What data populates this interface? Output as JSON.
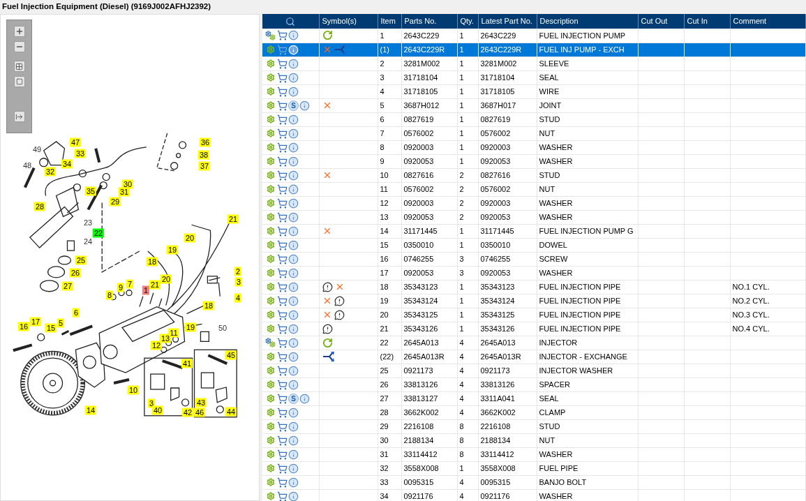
{
  "title": "Fuel Injection Equipment (Diesel) (9169J002AFHJ2392)",
  "diagram": {
    "callouts": [
      {
        "label": "47",
        "color": "#ffff00"
      },
      {
        "label": "49"
      },
      {
        "label": "48"
      },
      {
        "label": "33",
        "color": "#ffff00"
      },
      {
        "label": "34",
        "color": "#ffff00"
      },
      {
        "label": "32",
        "color": "#ffff00"
      },
      {
        "label": "36",
        "color": "#ffff00"
      },
      {
        "label": "38",
        "color": "#ffff00"
      },
      {
        "label": "37",
        "color": "#ffff00"
      },
      {
        "label": "30",
        "color": "#ffff00"
      },
      {
        "label": "31",
        "color": "#ffff00"
      },
      {
        "label": "35",
        "color": "#ffff00"
      },
      {
        "label": "29",
        "color": "#ffff00"
      },
      {
        "label": "28",
        "color": "#ffff00"
      },
      {
        "label": "23"
      },
      {
        "label": "22",
        "color": "#00ff00"
      },
      {
        "label": "24"
      },
      {
        "label": "21",
        "color": "#ffff00"
      },
      {
        "label": "20",
        "color": "#ffff00"
      },
      {
        "label": "19",
        "color": "#ffff00"
      },
      {
        "label": "18",
        "color": "#ffff00"
      },
      {
        "label": "25",
        "color": "#ffff00"
      },
      {
        "label": "26",
        "color": "#ffff00"
      },
      {
        "label": "27",
        "color": "#ffff00"
      },
      {
        "label": "2",
        "color": "#ffff00"
      },
      {
        "label": "3",
        "color": "#ffff00"
      },
      {
        "label": "4",
        "color": "#ffff00"
      },
      {
        "label": "1",
        "color": "#f08080"
      },
      {
        "label": "7",
        "color": "#ffff00"
      },
      {
        "label": "9",
        "color": "#ffff00"
      },
      {
        "label": "8",
        "color": "#ffff00"
      },
      {
        "label": "21",
        "color": "#ffff00"
      },
      {
        "label": "20",
        "color": "#ffff00"
      },
      {
        "label": "18",
        "color": "#ffff00"
      },
      {
        "label": "6",
        "color": "#ffff00"
      },
      {
        "label": "17",
        "color": "#ffff00"
      },
      {
        "label": "16",
        "color": "#ffff00"
      },
      {
        "label": "15",
        "color": "#ffff00"
      },
      {
        "label": "5",
        "color": "#ffff00"
      },
      {
        "label": "19",
        "color": "#ffff00"
      },
      {
        "label": "11",
        "color": "#ffff00"
      },
      {
        "label": "13",
        "color": "#ffff00"
      },
      {
        "label": "12",
        "color": "#ffff00"
      },
      {
        "label": "50"
      },
      {
        "label": "10",
        "color": "#ffff00"
      },
      {
        "label": "14",
        "color": "#ffff00"
      },
      {
        "label": "41",
        "color": "#ffff00"
      },
      {
        "label": "45",
        "color": "#ffff00"
      },
      {
        "label": "3",
        "color": "#ffff00"
      },
      {
        "label": "40",
        "color": "#ffff00"
      },
      {
        "label": "42",
        "color": "#ffff00"
      },
      {
        "label": "43",
        "color": "#ffff00"
      },
      {
        "label": "46",
        "color": "#ffff00"
      },
      {
        "label": "44",
        "color": "#ffff00"
      }
    ]
  },
  "table": {
    "columns": [
      "Symbol(s)",
      "Item",
      "Parts No.",
      "Qty.",
      "Latest Part No.",
      "Description",
      "Cut Out",
      "Cut In",
      "Comment"
    ],
    "rows": [
      {
        "icons": [
          {
            "kind": "gears"
          },
          {
            "kind": "cart"
          },
          {
            "kind": "info"
          }
        ],
        "symbols": [
          {
            "kind": "replaced"
          }
        ],
        "item": "1",
        "parts_no": "2643C229",
        "qty": "1",
        "latest": "2643C229",
        "description": "FUEL INJECTION PUMP",
        "selected": false
      },
      {
        "icons": [
          {
            "kind": "gear"
          },
          {
            "kind": "cart"
          },
          {
            "kind": "info"
          }
        ],
        "symbols": [
          {
            "kind": "cross"
          },
          {
            "kind": "exchange"
          }
        ],
        "item": "(1)",
        "parts_no": "2643C229R",
        "qty": "1",
        "latest": "2643C229R",
        "description": "FUEL INJ PUMP - EXCH",
        "selected": true
      },
      {
        "icons": [
          {
            "kind": "gear"
          },
          {
            "kind": "cart"
          },
          {
            "kind": "info"
          }
        ],
        "symbols": [],
        "item": "2",
        "parts_no": "3281M002",
        "qty": "1",
        "latest": "3281M002",
        "description": "SLEEVE",
        "selected": false
      },
      {
        "icons": [
          {
            "kind": "gear"
          },
          {
            "kind": "cart"
          },
          {
            "kind": "info"
          }
        ],
        "symbols": [],
        "item": "3",
        "parts_no": "31718104",
        "qty": "1",
        "latest": "31718104",
        "description": "SEAL",
        "selected": false
      },
      {
        "icons": [
          {
            "kind": "gear"
          },
          {
            "kind": "cart"
          },
          {
            "kind": "info"
          }
        ],
        "symbols": [],
        "item": "4",
        "parts_no": "31718105",
        "qty": "1",
        "latest": "31718105",
        "description": "WIRE",
        "selected": false
      },
      {
        "icons": [
          {
            "kind": "gear"
          },
          {
            "kind": "cart"
          },
          {
            "kind": "badge",
            "label": "S"
          },
          {
            "kind": "info"
          }
        ],
        "symbols": [
          {
            "kind": "cross"
          }
        ],
        "item": "5",
        "parts_no": "3687H012",
        "qty": "1",
        "latest": "3687H017",
        "description": "JOINT",
        "selected": false
      },
      {
        "icons": [
          {
            "kind": "gear"
          },
          {
            "kind": "cart"
          },
          {
            "kind": "info"
          }
        ],
        "symbols": [],
        "item": "6",
        "parts_no": "0827619",
        "qty": "1",
        "latest": "0827619",
        "description": "STUD",
        "selected": false
      },
      {
        "icons": [
          {
            "kind": "gear"
          },
          {
            "kind": "cart"
          },
          {
            "kind": "info"
          }
        ],
        "symbols": [],
        "item": "7",
        "parts_no": "0576002",
        "qty": "1",
        "latest": "0576002",
        "description": "NUT",
        "selected": false
      },
      {
        "icons": [
          {
            "kind": "gear"
          },
          {
            "kind": "cart"
          },
          {
            "kind": "info"
          }
        ],
        "symbols": [],
        "item": "8",
        "parts_no": "0920003",
        "qty": "1",
        "latest": "0920003",
        "description": "WASHER",
        "selected": false
      },
      {
        "icons": [
          {
            "kind": "gear"
          },
          {
            "kind": "cart"
          },
          {
            "kind": "info"
          }
        ],
        "symbols": [],
        "item": "9",
        "parts_no": "0920053",
        "qty": "1",
        "latest": "0920053",
        "description": "WASHER",
        "selected": false
      },
      {
        "icons": [
          {
            "kind": "gear"
          },
          {
            "kind": "cart"
          },
          {
            "kind": "info"
          }
        ],
        "symbols": [
          {
            "kind": "cross"
          }
        ],
        "item": "10",
        "parts_no": "0827616",
        "qty": "2",
        "latest": "0827616",
        "description": "STUD",
        "selected": false
      },
      {
        "icons": [
          {
            "kind": "gear"
          },
          {
            "kind": "cart"
          },
          {
            "kind": "info"
          }
        ],
        "symbols": [],
        "item": "11",
        "parts_no": "0576002",
        "qty": "2",
        "latest": "0576002",
        "description": "NUT",
        "selected": false
      },
      {
        "icons": [
          {
            "kind": "gear"
          },
          {
            "kind": "cart"
          },
          {
            "kind": "info"
          }
        ],
        "symbols": [],
        "item": "12",
        "parts_no": "0920003",
        "qty": "2",
        "latest": "0920003",
        "description": "WASHER",
        "selected": false
      },
      {
        "icons": [
          {
            "kind": "gear"
          },
          {
            "kind": "cart"
          },
          {
            "kind": "info"
          }
        ],
        "symbols": [],
        "item": "13",
        "parts_no": "0920053",
        "qty": "2",
        "latest": "0920053",
        "description": "WASHER",
        "selected": false
      },
      {
        "icons": [
          {
            "kind": "gear"
          },
          {
            "kind": "cart"
          },
          {
            "kind": "info"
          }
        ],
        "symbols": [
          {
            "kind": "cross"
          }
        ],
        "item": "14",
        "parts_no": "31171445",
        "qty": "1",
        "latest": "31171445",
        "description": "FUEL INJECTION PUMP G",
        "selected": false
      },
      {
        "icons": [
          {
            "kind": "gear"
          },
          {
            "kind": "cart"
          },
          {
            "kind": "info"
          }
        ],
        "symbols": [],
        "item": "15",
        "parts_no": "0350010",
        "qty": "1",
        "latest": "0350010",
        "description": "DOWEL",
        "selected": false
      },
      {
        "icons": [
          {
            "kind": "gear"
          },
          {
            "kind": "cart"
          },
          {
            "kind": "info"
          }
        ],
        "symbols": [],
        "item": "16",
        "parts_no": "0746255",
        "qty": "3",
        "latest": "0746255",
        "description": "SCREW",
        "selected": false
      },
      {
        "icons": [
          {
            "kind": "gear"
          },
          {
            "kind": "cart"
          },
          {
            "kind": "info"
          }
        ],
        "symbols": [],
        "item": "17",
        "parts_no": "0920053",
        "qty": "3",
        "latest": "0920053",
        "description": "WASHER",
        "selected": false
      },
      {
        "icons": [
          {
            "kind": "gear"
          },
          {
            "kind": "cart"
          },
          {
            "kind": "info"
          }
        ],
        "symbols": [
          {
            "kind": "note"
          },
          {
            "kind": "cross"
          }
        ],
        "item": "18",
        "parts_no": "35343123",
        "qty": "1",
        "latest": "35343123",
        "description": "FUEL INJECTION PIPE",
        "comment": "NO.1 CYL.",
        "selected": false
      },
      {
        "icons": [
          {
            "kind": "gear"
          },
          {
            "kind": "cart"
          },
          {
            "kind": "info"
          }
        ],
        "symbols": [
          {
            "kind": "cross"
          },
          {
            "kind": "note"
          }
        ],
        "item": "19",
        "parts_no": "35343124",
        "qty": "1",
        "latest": "35343124",
        "description": "FUEL INJECTION PIPE",
        "comment": "NO.2 CYL.",
        "selected": false
      },
      {
        "icons": [
          {
            "kind": "gear"
          },
          {
            "kind": "cart"
          },
          {
            "kind": "info"
          }
        ],
        "symbols": [
          {
            "kind": "cross"
          },
          {
            "kind": "note"
          }
        ],
        "item": "20",
        "parts_no": "35343125",
        "qty": "1",
        "latest": "35343125",
        "description": "FUEL INJECTION PIPE",
        "comment": "NO.3 CYL.",
        "selected": false
      },
      {
        "icons": [
          {
            "kind": "gear"
          },
          {
            "kind": "cart"
          },
          {
            "kind": "info"
          }
        ],
        "symbols": [
          {
            "kind": "note"
          }
        ],
        "item": "21",
        "parts_no": "35343126",
        "qty": "1",
        "latest": "35343126",
        "description": "FUEL INJECTION PIPE",
        "comment": "NO.4 CYL.",
        "selected": false
      },
      {
        "icons": [
          {
            "kind": "gears"
          },
          {
            "kind": "cart"
          },
          {
            "kind": "info"
          }
        ],
        "symbols": [
          {
            "kind": "replaced"
          }
        ],
        "item": "22",
        "parts_no": "2645A013",
        "qty": "4",
        "latest": "2645A013",
        "description": "INJECTOR",
        "selected": false
      },
      {
        "icons": [
          {
            "kind": "gear"
          },
          {
            "kind": "cart"
          },
          {
            "kind": "info"
          }
        ],
        "symbols": [
          {
            "kind": "exchange"
          }
        ],
        "item": "(22)",
        "parts_no": "2645A013R",
        "qty": "4",
        "latest": "2645A013R",
        "description": "INJECTOR - EXCHANGE",
        "selected": false
      },
      {
        "icons": [
          {
            "kind": "gear"
          },
          {
            "kind": "cart"
          },
          {
            "kind": "info"
          }
        ],
        "symbols": [],
        "item": "25",
        "parts_no": "0921173",
        "qty": "4",
        "latest": "0921173",
        "description": "INJECTOR WASHER",
        "selected": false
      },
      {
        "icons": [
          {
            "kind": "gear"
          },
          {
            "kind": "cart"
          },
          {
            "kind": "info"
          }
        ],
        "symbols": [],
        "item": "26",
        "parts_no": "33813126",
        "qty": "4",
        "latest": "33813126",
        "description": "SPACER",
        "selected": false
      },
      {
        "icons": [
          {
            "kind": "gear"
          },
          {
            "kind": "cart"
          },
          {
            "kind": "badge",
            "label": "S"
          },
          {
            "kind": "info"
          }
        ],
        "symbols": [],
        "item": "27",
        "parts_no": "33813127",
        "qty": "4",
        "latest": "3311A041",
        "description": "SEAL",
        "selected": false
      },
      {
        "icons": [
          {
            "kind": "gear"
          },
          {
            "kind": "cart"
          },
          {
            "kind": "info"
          }
        ],
        "symbols": [],
        "item": "28",
        "parts_no": "3662K002",
        "qty": "4",
        "latest": "3662K002",
        "description": "CLAMP",
        "selected": false
      },
      {
        "icons": [
          {
            "kind": "gear"
          },
          {
            "kind": "cart"
          },
          {
            "kind": "info"
          }
        ],
        "symbols": [],
        "item": "29",
        "parts_no": "2216108",
        "qty": "8",
        "latest": "2216108",
        "description": "STUD",
        "selected": false
      },
      {
        "icons": [
          {
            "kind": "gear"
          },
          {
            "kind": "cart"
          },
          {
            "kind": "info"
          }
        ],
        "symbols": [],
        "item": "30",
        "parts_no": "2188134",
        "qty": "8",
        "latest": "2188134",
        "description": "NUT",
        "selected": false
      },
      {
        "icons": [
          {
            "kind": "gear"
          },
          {
            "kind": "cart"
          },
          {
            "kind": "info"
          }
        ],
        "symbols": [],
        "item": "31",
        "parts_no": "33114412",
        "qty": "8",
        "latest": "33114412",
        "description": "WASHER",
        "selected": false
      },
      {
        "icons": [
          {
            "kind": "gear"
          },
          {
            "kind": "cart"
          },
          {
            "kind": "info"
          }
        ],
        "symbols": [],
        "item": "32",
        "parts_no": "3558X008",
        "qty": "1",
        "latest": "3558X008",
        "description": "FUEL PIPE",
        "selected": false
      },
      {
        "icons": [
          {
            "kind": "gear"
          },
          {
            "kind": "cart"
          },
          {
            "kind": "info"
          }
        ],
        "symbols": [],
        "item": "33",
        "parts_no": "0095315",
        "qty": "4",
        "latest": "0095315",
        "description": "BANJO BOLT",
        "selected": false
      },
      {
        "icons": [
          {
            "kind": "gear"
          },
          {
            "kind": "cart"
          },
          {
            "kind": "info"
          }
        ],
        "symbols": [],
        "item": "34",
        "parts_no": "0921176",
        "qty": "4",
        "latest": "0921176",
        "description": "WASHER",
        "selected": false
      }
    ]
  }
}
